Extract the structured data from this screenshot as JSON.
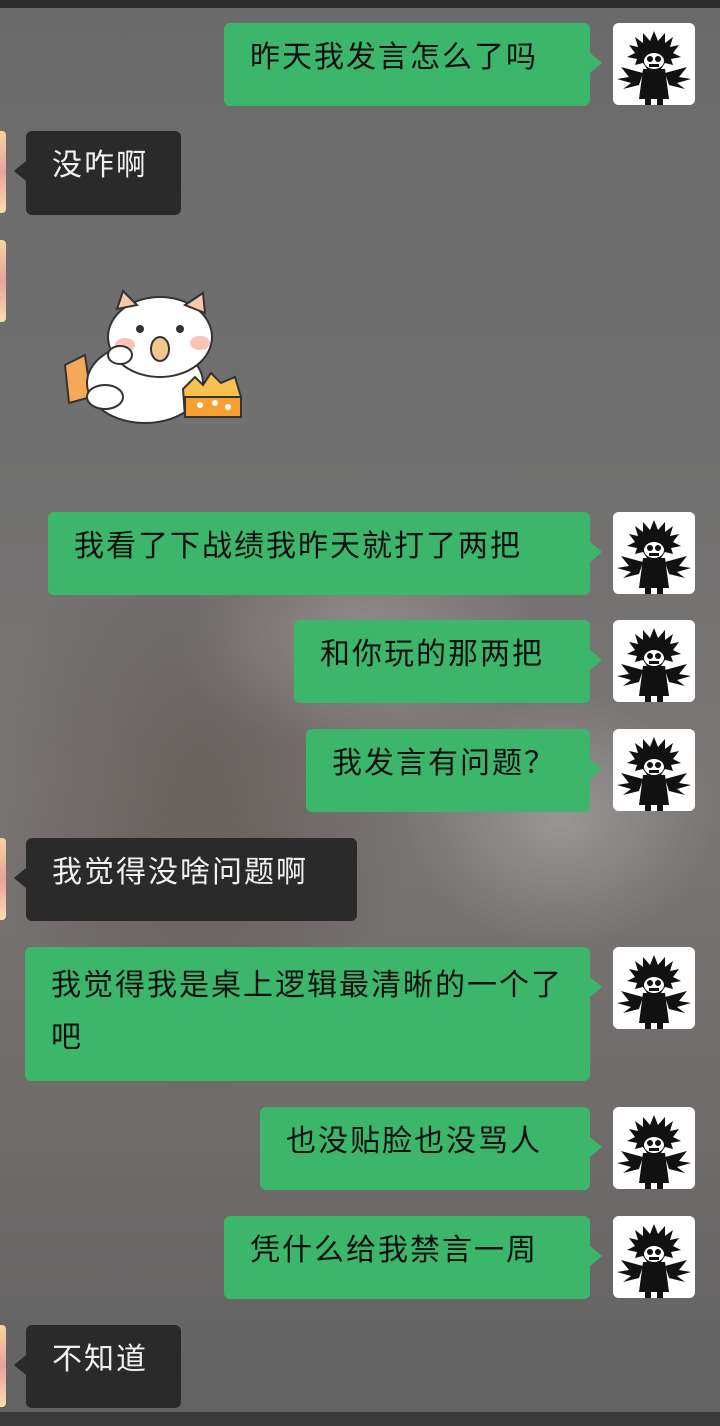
{
  "messages": [
    {
      "side": "out",
      "text": "昨天我发言怎么了吗"
    },
    {
      "side": "in",
      "text": "没咋啊"
    },
    {
      "side": "in",
      "sticker": "cat-eating-cake-sticker"
    },
    {
      "side": "out",
      "text": "我看了下战绩我昨天就打了两把"
    },
    {
      "side": "out",
      "text": "和你玩的那两把"
    },
    {
      "side": "out",
      "text": "我发言有问题？"
    },
    {
      "side": "in",
      "text": "我觉得没啥问题啊"
    },
    {
      "side": "out",
      "text": "我觉得我是桌上逻辑最清晰的一个了吧"
    },
    {
      "side": "out",
      "text": "也没贴脸也没骂人"
    },
    {
      "side": "out",
      "text": "凭什么给我禁言一周"
    },
    {
      "side": "in",
      "text": "不知道"
    }
  ],
  "colors": {
    "outgoing_bubble": "#3cb66a",
    "incoming_bubble": "#2a2a2a",
    "background": "#6b6b6b"
  },
  "icons": {
    "self_avatar": "spiky-hair-cartoon-avatar",
    "other_avatar": "pastel-avatar-partial"
  }
}
